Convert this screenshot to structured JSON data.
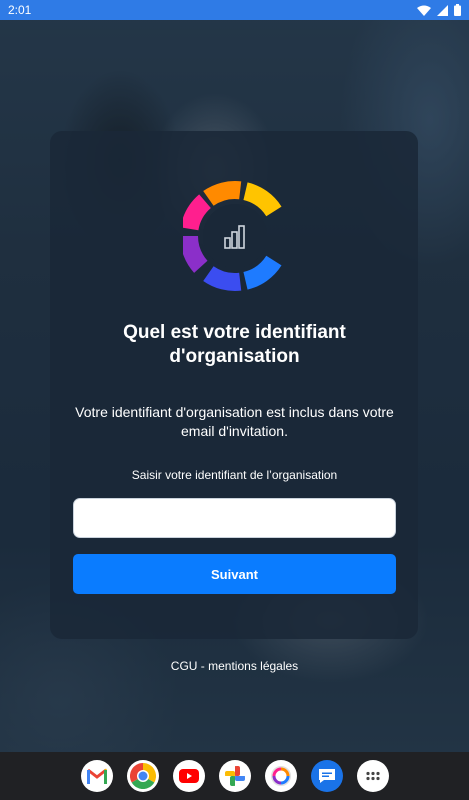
{
  "status_bar": {
    "time": "2:01"
  },
  "login": {
    "title_line1": "Quel est votre identifiant",
    "title_line2": "d'organisation",
    "subtitle_line1": "Votre identifiant d'organisation est inclus dans votre",
    "subtitle_line2": "email d'invitation.",
    "field_label": "Saisir votre identifiant de l’organisation",
    "input_value": "",
    "next_label": "Suivant",
    "legal_link": "CGU - mentions légales"
  },
  "colors": {
    "status_bar": "#2f7be6",
    "primary_button": "#0a7cff",
    "card_background": "#1a2838"
  },
  "dock": {
    "apps": [
      "gmail-icon",
      "chrome-icon",
      "youtube-icon",
      "photos-icon",
      "app-icon",
      "messages-icon",
      "app-drawer-icon"
    ]
  }
}
